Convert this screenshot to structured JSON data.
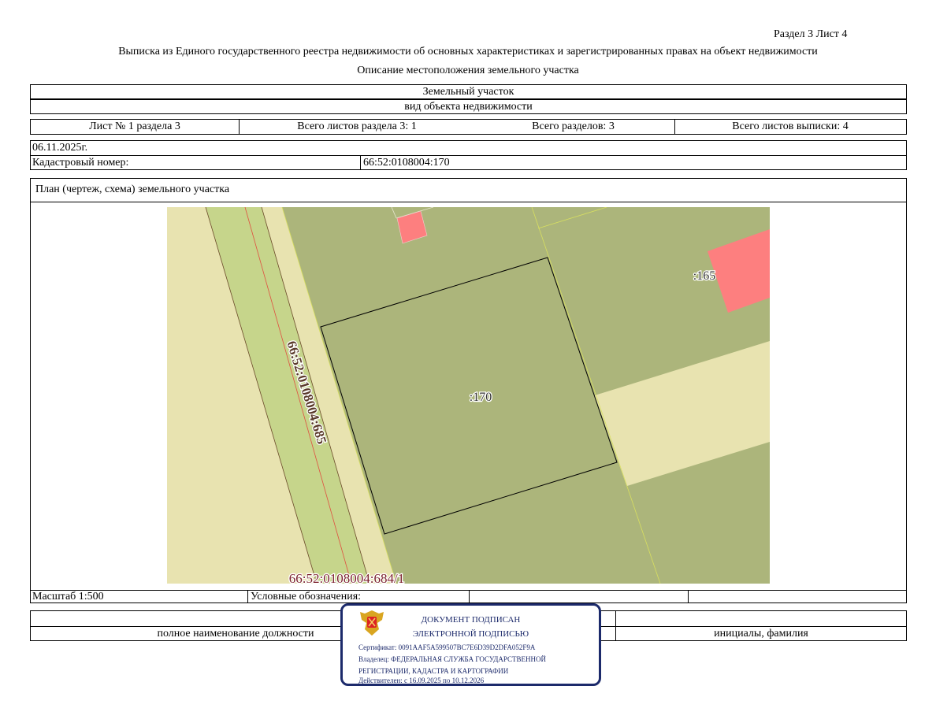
{
  "header": {
    "section_sheet": "Раздел 3    Лист 4",
    "title": "Выписка из Единого государственного реестра недвижимости об основных характеристиках и зарегистрированных правах на объект недвижимости",
    "subtitle": "Описание местоположения земельного участка"
  },
  "object": {
    "type": "Земельный участок",
    "type_caption": "вид объекта недвижимости"
  },
  "sheets": {
    "sheet": "Лист № 1 раздела 3",
    "total_section": "Всего листов раздела 3: 1",
    "total_sections": "Всего разделов: 3",
    "total_sheets": "Всего листов выписки: 4"
  },
  "date": "06.11.2025г.",
  "cadastral": {
    "label": "Кадастровый номер:",
    "value": "66:52:0108004:170"
  },
  "plan": {
    "title": "План (чертеж, схема) земельного участка",
    "labels": {
      "main": ":170",
      "neighbor": ":165",
      "road": "66:52:0108004:685",
      "bottom": "66:52:0108004:684/1"
    },
    "colors": {
      "beige": "#e8e3b0",
      "olive": "#acb57b",
      "light_green": "#c6d58b",
      "pink": "#fd7f7f",
      "label_red": "#7a1f2b"
    }
  },
  "footer": {
    "scale": "Масштаб 1:500",
    "legend": "Условные обозначения:",
    "position": "полное наименование должности",
    "name": "инициалы, фамилия"
  },
  "stamp": {
    "line1": "ДОКУМЕНТ ПОДПИСАН",
    "line2": "ЭЛЕКТРОННОЙ ПОДПИСЬЮ",
    "certificate": "Сертификат: 0091AAF5A599507BC7E6D39D2DFA052F9A",
    "owner1": "Владелец: ФЕДЕРАЛЬНАЯ СЛУЖБА ГОСУДАРСТВЕННОЙ",
    "owner2": "РЕГИСТРАЦИИ, КАДАСТРА И КАРТОГРАФИИ",
    "valid": "Действителен: с 16.09.2025 по 10.12.2026",
    "color": "#1c2a6b"
  }
}
